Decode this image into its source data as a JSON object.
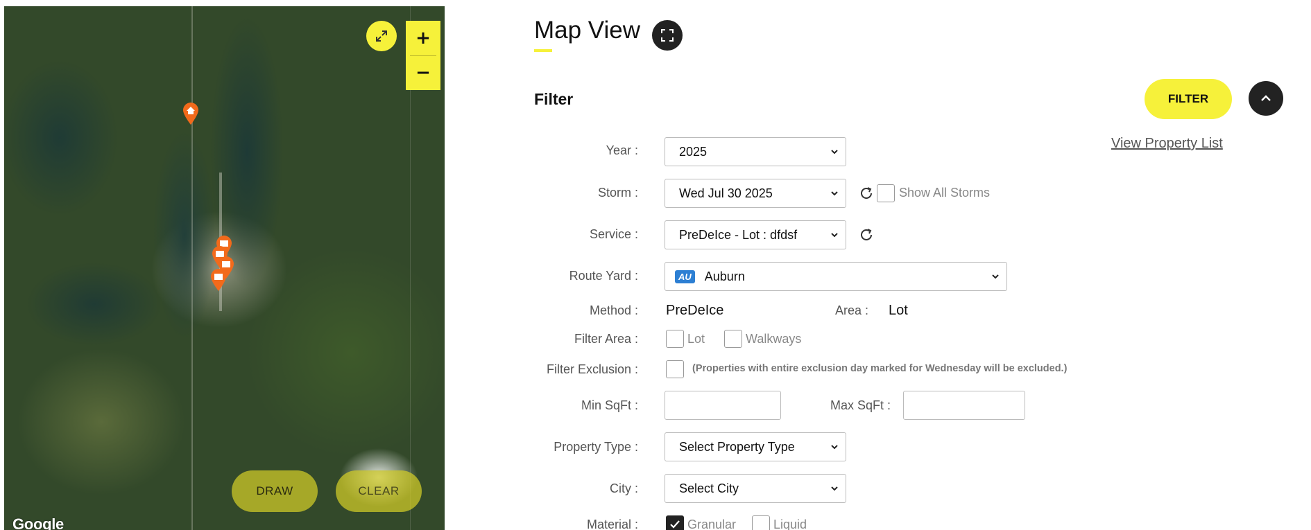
{
  "map": {
    "fullscreen_icon": "expand-arrows-icon",
    "zoom_in_label": "+",
    "zoom_out_label": "−",
    "draw_label": "DRAW",
    "clear_label": "CLEAR",
    "attribution": "Google",
    "marker_color": "#f26a1b"
  },
  "header": {
    "title": "Map View",
    "accent": "#f6f13a"
  },
  "filter": {
    "heading": "Filter",
    "filter_button": "FILTER",
    "view_property_list": "View Property List",
    "year": {
      "label": "Year :",
      "value": "2025"
    },
    "storm": {
      "label": "Storm :",
      "value": "Wed Jul 30 2025",
      "show_all_label": "Show All Storms",
      "show_all_checked": false
    },
    "service": {
      "label": "Service :",
      "value": "PreDeIce - Lot : dfdsf"
    },
    "route_yard": {
      "label": "Route Yard :",
      "badge": "AU",
      "value": "Auburn"
    },
    "method": {
      "label": "Method :",
      "value": "PreDeIce"
    },
    "area": {
      "label": "Area :",
      "value": "Lot"
    },
    "filter_area": {
      "label": "Filter Area :",
      "options": [
        "Lot",
        "Walkways"
      ]
    },
    "filter_exclusion": {
      "label": "Filter Exclusion :",
      "note": "(Properties with entire exclusion day marked for Wednesday will be excluded.)"
    },
    "min_sqft": {
      "label": "Min SqFt :",
      "value": ""
    },
    "max_sqft": {
      "label": "Max SqFt :",
      "value": ""
    },
    "property_type": {
      "label": "Property Type :",
      "value": "Select Property Type"
    },
    "city": {
      "label": "City :",
      "value": "Select City"
    },
    "material": {
      "label": "Material :",
      "options": [
        {
          "label": "Granular",
          "checked": true
        },
        {
          "label": "Liquid",
          "checked": false
        }
      ]
    }
  }
}
